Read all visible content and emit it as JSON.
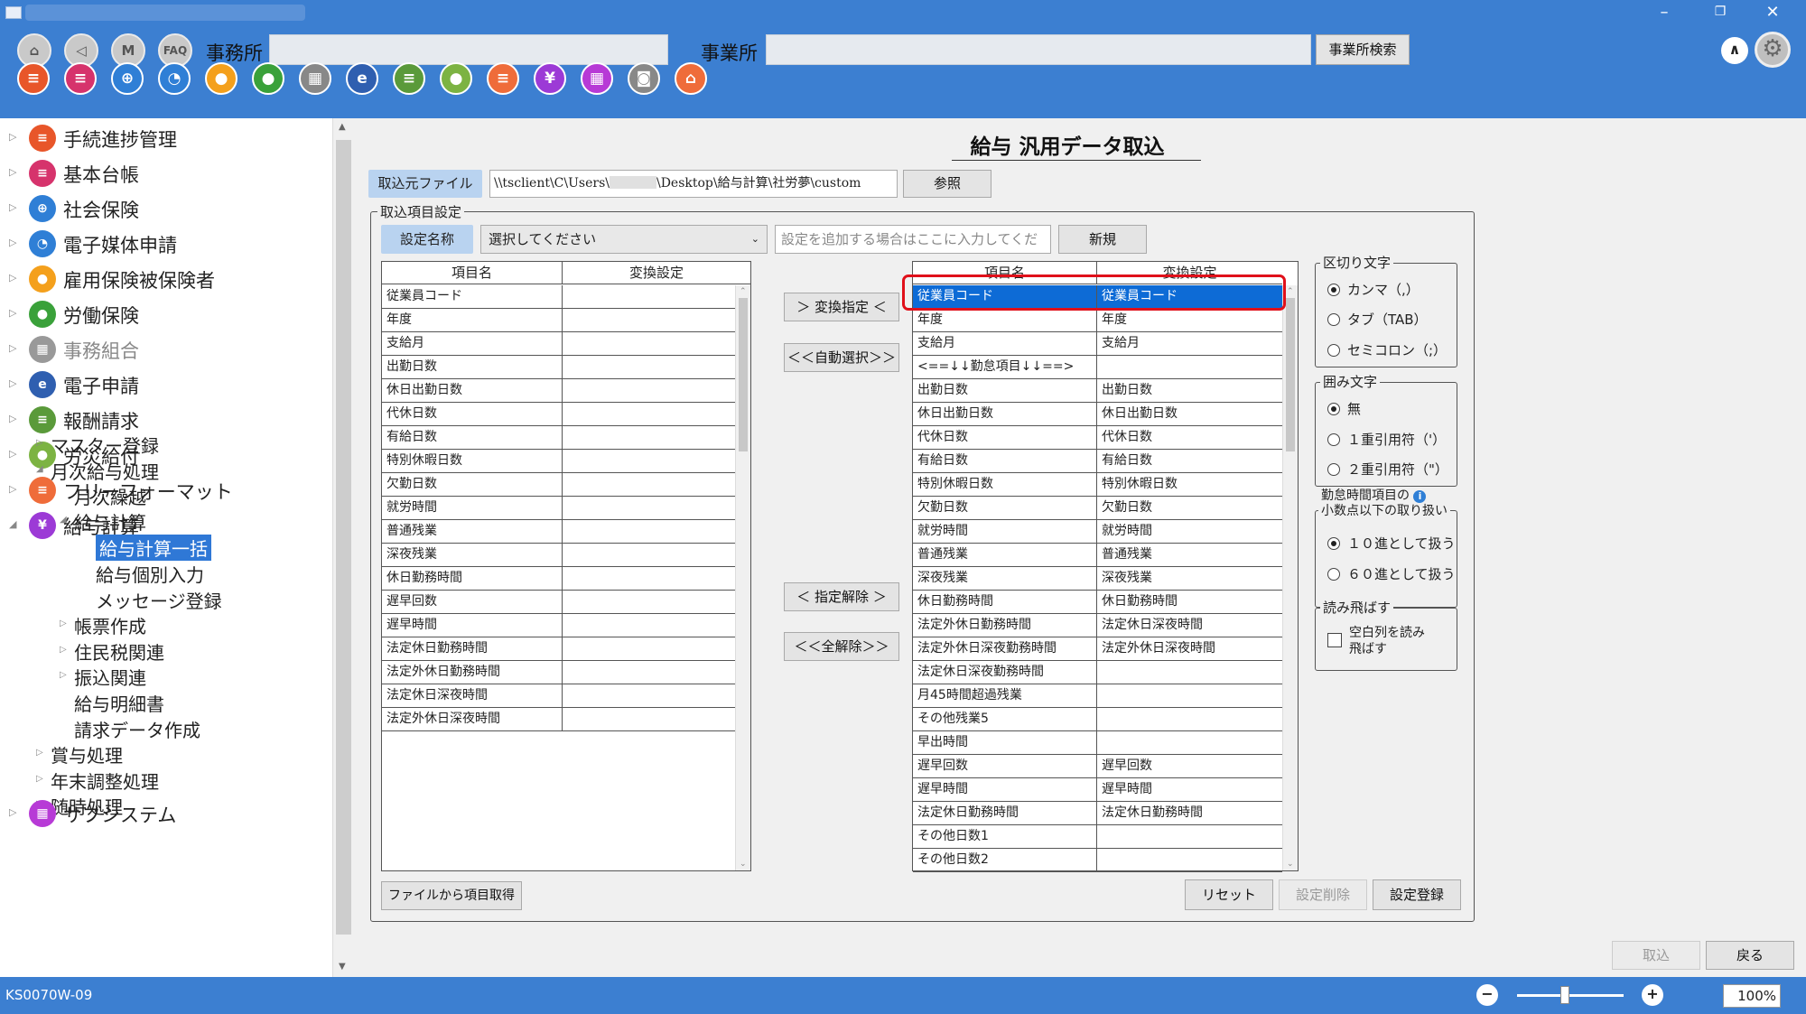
{
  "header": {
    "office_label": "事務所",
    "establishment_label": "事業所",
    "office_search_label": "事業所検索",
    "nav_buttons": [
      "⌂",
      "◁",
      "M",
      "FAQ"
    ]
  },
  "toolbar_icons": [
    {
      "name": "procedure-icon",
      "color": "#e8562a",
      "glyph": "≡"
    },
    {
      "name": "ledger-icon",
      "color": "#d6336c",
      "glyph": "≡"
    },
    {
      "name": "social-insurance-icon",
      "color": "#2f7fd6",
      "glyph": "⊕"
    },
    {
      "name": "media-icon",
      "color": "#2f7fd6",
      "glyph": "◔"
    },
    {
      "name": "employment-icon",
      "color": "#f4a01c",
      "glyph": "●"
    },
    {
      "name": "labor-icon",
      "color": "#3aa13a",
      "glyph": "●"
    },
    {
      "name": "union-icon",
      "color": "#888888",
      "glyph": "▦"
    },
    {
      "name": "e-application-icon",
      "color": "#2f5fb0",
      "glyph": "e"
    },
    {
      "name": "report-icon",
      "color": "#5a9a3a",
      "glyph": "≡"
    },
    {
      "name": "accident-icon",
      "color": "#7cb342",
      "glyph": "●"
    },
    {
      "name": "free-format-icon",
      "color": "#ef6c3a",
      "glyph": "≡"
    },
    {
      "name": "payroll-icon",
      "color": "#9c3ad6",
      "glyph": "¥"
    },
    {
      "name": "subsystem-icon",
      "color": "#b73ad6",
      "glyph": "▦"
    },
    {
      "name": "camera-icon",
      "color": "#888888",
      "glyph": "◙"
    },
    {
      "name": "home-icon",
      "color": "#ef6c3a",
      "glyph": "⌂"
    }
  ],
  "sidebar": {
    "items": [
      {
        "label": "手続進捗管理",
        "color": "#e8562a",
        "glyph": "≡"
      },
      {
        "label": "基本台帳",
        "color": "#d6336c",
        "glyph": "≡"
      },
      {
        "label": "社会保険",
        "color": "#2f7fd6",
        "glyph": "⊕"
      },
      {
        "label": "電子媒体申請",
        "color": "#2f7fd6",
        "glyph": "◔"
      },
      {
        "label": "雇用保険被保険者",
        "color": "#f4a01c",
        "glyph": "●"
      },
      {
        "label": "労働保険",
        "color": "#3aa13a",
        "glyph": "●"
      },
      {
        "label": "事務組合",
        "color": "#999999",
        "glyph": "▦"
      },
      {
        "label": "電子申請",
        "color": "#2f5fb0",
        "glyph": "e"
      },
      {
        "label": "報酬請求",
        "color": "#5a9a3a",
        "glyph": "≡"
      },
      {
        "label": "労災給付",
        "color": "#7cb342",
        "glyph": "●"
      },
      {
        "label": "フリーフォーマット",
        "color": "#ef6c3a",
        "glyph": "≡"
      },
      {
        "label": "給与計算",
        "color": "#9c3ad6",
        "glyph": "¥"
      }
    ],
    "subitems": [
      "マスター登録",
      "月次給与処理",
      "月次繰越",
      "給与計算",
      "給与計算一括",
      "給与個別入力",
      "メッセージ登録",
      "帳票作成",
      "住民税関連",
      "振込関連",
      "給与明細書",
      "請求データ作成",
      "賞与処理",
      "年末調整処理",
      "随時処理"
    ],
    "subsystem": {
      "label": "サブシステム",
      "color": "#b73ad6",
      "glyph": "▦"
    },
    "partial_label": "データ"
  },
  "page": {
    "title": "給与 汎用データ取込",
    "source_file_label": "取込元ファイル",
    "source_file_path_prefix": "\\\\tsclient\\C\\Users\\",
    "source_file_path_suffix": "\\Desktop\\給与計算\\社労夢\\custom",
    "browse_label": "参照",
    "import_settings_legend": "取込項目設定",
    "setting_name_label": "設定名称",
    "setting_select_value": "選択してください",
    "new_setting_placeholder": "設定を追加する場合はここに入力してくだ",
    "new_label": "新規"
  },
  "left_grid": {
    "headers": [
      "項目名",
      "変換設定"
    ],
    "rows": [
      "従業員コード",
      "年度",
      "支給月",
      "出勤日数",
      "休日出勤日数",
      "代休日数",
      "有給日数",
      "特別休暇日数",
      "欠勤日数",
      "就労時間",
      "普通残業",
      "深夜残業",
      "休日勤務時間",
      "遅早回数",
      "遅早時間",
      "法定休日勤務時間",
      "法定外休日勤務時間",
      "法定休日深夜時間",
      "法定外休日深夜時間"
    ]
  },
  "middle_buttons": {
    "assign": "＞ 変換指定 ＜",
    "auto_select": "＜＜自動選択＞＞",
    "release": "＜ 指定解除 ＞",
    "release_all": "＜＜全解除＞＞"
  },
  "right_grid": {
    "headers": [
      "項目名",
      "変換設定"
    ],
    "rows": [
      [
        "従業員コード",
        "従業員コード"
      ],
      [
        "年度",
        "年度"
      ],
      [
        "支給月",
        "支給月"
      ],
      [
        "<==↓↓勤怠項目↓↓==>",
        ""
      ],
      [
        "出勤日数",
        "出勤日数"
      ],
      [
        "休日出勤日数",
        "休日出勤日数"
      ],
      [
        "代休日数",
        "代休日数"
      ],
      [
        "有給日数",
        "有給日数"
      ],
      [
        "特別休暇日数",
        "特別休暇日数"
      ],
      [
        "欠勤日数",
        "欠勤日数"
      ],
      [
        "就労時間",
        "就労時間"
      ],
      [
        "普通残業",
        "普通残業"
      ],
      [
        "深夜残業",
        "深夜残業"
      ],
      [
        "休日勤務時間",
        "休日勤務時間"
      ],
      [
        "法定外休日勤務時間",
        "法定休日深夜時間"
      ],
      [
        "法定外休日深夜勤務時間",
        "法定外休日深夜時間"
      ],
      [
        "法定休日深夜勤務時間",
        ""
      ],
      [
        "月45時間超過残業",
        ""
      ],
      [
        "その他残業5",
        ""
      ],
      [
        "早出時間",
        ""
      ],
      [
        "遅早回数",
        "遅早回数"
      ],
      [
        "遅早時間",
        "遅早時間"
      ],
      [
        "法定休日勤務時間",
        "法定休日勤務時間"
      ],
      [
        "その他日数1",
        ""
      ],
      [
        "その他日数2",
        ""
      ]
    ]
  },
  "options": {
    "delimiter": {
      "legend": "区切り文字",
      "items": [
        "カンマ（,）",
        "タブ（TAB）",
        "セミコロン（;）"
      ],
      "selected": 0
    },
    "quote": {
      "legend": "囲み文字",
      "items": [
        "無",
        "１重引用符（'）",
        "２重引用符（\"）"
      ],
      "selected": 0
    },
    "decimal": {
      "legend_line1": "勤怠時間項目の",
      "legend_line2": "小数点以下の取り扱い",
      "items": [
        "１０進として扱う",
        "６０進として扱う"
      ],
      "selected": 0
    },
    "skip": {
      "legend": "読み飛ばす",
      "checkbox_label_line1": "空白列を読み",
      "checkbox_label_line2": "飛ばす",
      "checked": false
    }
  },
  "bottom_buttons": {
    "get_from_file": "ファイルから項目取得",
    "reset": "リセット",
    "delete_setting": "設定削除",
    "register_setting": "設定登録",
    "import": "取込",
    "back": "戻る"
  },
  "status": {
    "screen_id": "KS0070W-09",
    "zoom": "100%",
    "zoom_fraction": 0.45
  }
}
